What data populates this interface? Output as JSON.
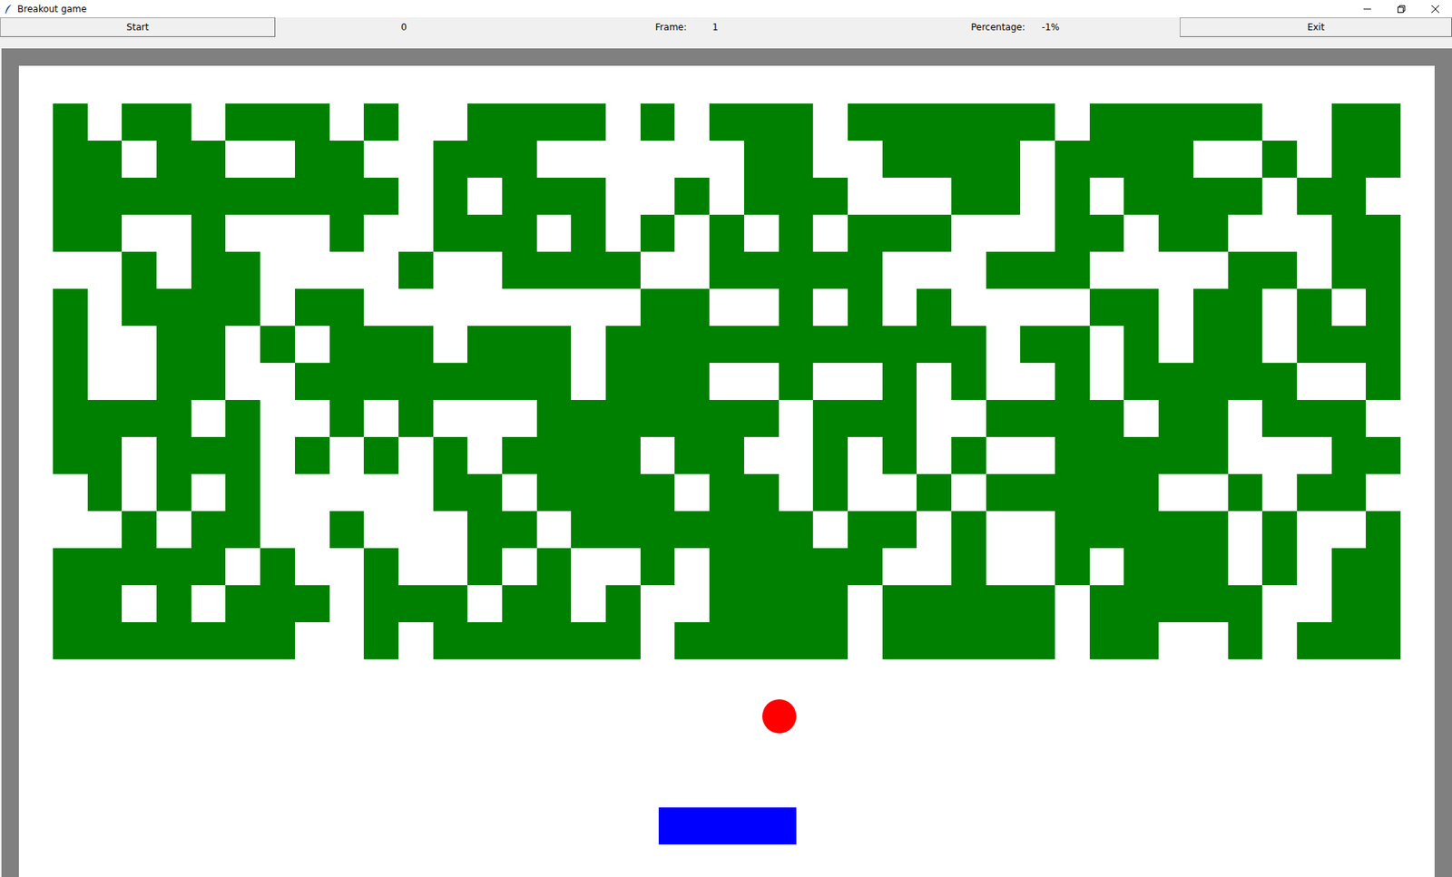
{
  "window": {
    "title": "Breakout game"
  },
  "toolbar": {
    "start_button": "Start",
    "score": "0",
    "frame_label": "Frame:",
    "frame_value": "1",
    "percentage_label": "Percentage:",
    "percentage_value": "-1%",
    "exit_button": "Exit"
  },
  "bricks": [
    [
      true,
      false,
      true,
      true,
      false,
      true,
      true,
      true,
      false,
      true,
      false,
      false,
      true,
      true,
      true,
      true,
      false,
      true,
      false,
      true,
      true,
      true,
      false,
      true,
      true,
      true,
      true,
      true,
      true,
      false,
      true,
      true,
      true,
      true,
      true,
      false,
      false,
      true,
      true
    ],
    [
      true,
      true,
      false,
      true,
      true,
      false,
      false,
      true,
      true,
      false,
      false,
      true,
      true,
      true,
      false,
      false,
      false,
      false,
      false,
      false,
      true,
      true,
      false,
      false,
      true,
      true,
      true,
      true,
      false,
      true,
      true,
      true,
      true,
      false,
      false,
      true,
      false,
      true,
      true
    ],
    [
      true,
      true,
      true,
      true,
      true,
      true,
      true,
      true,
      true,
      true,
      false,
      true,
      false,
      true,
      true,
      true,
      false,
      false,
      true,
      false,
      true,
      true,
      true,
      false,
      false,
      false,
      true,
      true,
      false,
      true,
      false,
      true,
      true,
      true,
      true,
      false,
      true,
      true,
      false
    ],
    [
      true,
      true,
      false,
      false,
      true,
      false,
      false,
      false,
      true,
      false,
      false,
      true,
      true,
      true,
      false,
      true,
      false,
      true,
      false,
      true,
      false,
      true,
      false,
      true,
      true,
      true,
      false,
      false,
      false,
      true,
      true,
      false,
      true,
      true,
      false,
      false,
      false,
      true,
      true
    ],
    [
      false,
      false,
      true,
      false,
      true,
      true,
      false,
      false,
      false,
      false,
      true,
      false,
      false,
      true,
      true,
      true,
      true,
      false,
      false,
      true,
      true,
      true,
      true,
      true,
      false,
      false,
      false,
      true,
      true,
      true,
      false,
      false,
      false,
      false,
      true,
      true,
      false,
      true,
      true
    ],
    [
      true,
      false,
      true,
      true,
      true,
      true,
      false,
      true,
      true,
      false,
      false,
      false,
      false,
      false,
      false,
      false,
      false,
      true,
      true,
      false,
      false,
      true,
      false,
      true,
      false,
      true,
      false,
      false,
      false,
      false,
      true,
      true,
      false,
      true,
      true,
      false,
      true,
      false,
      true
    ],
    [
      true,
      false,
      false,
      true,
      true,
      false,
      true,
      false,
      true,
      true,
      true,
      false,
      true,
      true,
      true,
      false,
      true,
      true,
      true,
      true,
      true,
      true,
      true,
      true,
      true,
      true,
      true,
      false,
      true,
      true,
      false,
      true,
      false,
      true,
      true,
      false,
      true,
      true,
      true
    ],
    [
      true,
      false,
      false,
      true,
      true,
      false,
      false,
      true,
      true,
      true,
      true,
      true,
      true,
      true,
      true,
      false,
      true,
      true,
      true,
      false,
      false,
      true,
      false,
      false,
      true,
      false,
      true,
      false,
      false,
      true,
      false,
      true,
      true,
      true,
      true,
      true,
      false,
      false,
      true
    ],
    [
      true,
      true,
      true,
      true,
      false,
      true,
      false,
      false,
      true,
      false,
      true,
      false,
      false,
      false,
      true,
      true,
      true,
      true,
      true,
      true,
      true,
      false,
      true,
      true,
      true,
      false,
      false,
      true,
      true,
      true,
      true,
      false,
      true,
      true,
      false,
      true,
      true,
      true,
      false
    ],
    [
      true,
      true,
      false,
      true,
      true,
      true,
      false,
      true,
      false,
      true,
      false,
      true,
      false,
      true,
      true,
      true,
      true,
      false,
      true,
      true,
      false,
      false,
      true,
      false,
      true,
      false,
      true,
      false,
      false,
      true,
      true,
      true,
      true,
      true,
      false,
      false,
      false,
      true,
      true
    ],
    [
      false,
      true,
      false,
      true,
      false,
      true,
      false,
      false,
      false,
      false,
      false,
      true,
      true,
      false,
      true,
      true,
      true,
      true,
      false,
      true,
      true,
      false,
      true,
      false,
      false,
      true,
      false,
      true,
      true,
      true,
      true,
      true,
      false,
      false,
      true,
      false,
      true,
      true,
      false
    ],
    [
      false,
      false,
      true,
      false,
      true,
      true,
      false,
      false,
      true,
      false,
      false,
      false,
      true,
      true,
      false,
      true,
      true,
      true,
      true,
      true,
      true,
      true,
      false,
      true,
      true,
      false,
      true,
      false,
      false,
      true,
      true,
      true,
      true,
      true,
      false,
      true,
      false,
      false,
      true
    ],
    [
      true,
      true,
      true,
      true,
      true,
      false,
      true,
      false,
      false,
      true,
      false,
      false,
      true,
      false,
      true,
      false,
      false,
      true,
      false,
      true,
      true,
      true,
      true,
      true,
      false,
      false,
      true,
      false,
      false,
      true,
      false,
      true,
      true,
      true,
      false,
      true,
      false,
      true,
      true
    ],
    [
      true,
      true,
      false,
      true,
      false,
      true,
      true,
      true,
      false,
      true,
      true,
      true,
      false,
      true,
      true,
      false,
      true,
      false,
      false,
      true,
      true,
      true,
      true,
      false,
      true,
      true,
      true,
      true,
      true,
      false,
      true,
      true,
      true,
      true,
      true,
      false,
      false,
      true,
      true
    ],
    [
      true,
      true,
      true,
      true,
      true,
      true,
      true,
      false,
      false,
      true,
      false,
      true,
      true,
      true,
      true,
      true,
      true,
      false,
      true,
      true,
      true,
      true,
      true,
      false,
      true,
      true,
      true,
      true,
      true,
      false,
      true,
      true,
      false,
      false,
      true,
      false,
      true,
      true,
      true
    ]
  ]
}
